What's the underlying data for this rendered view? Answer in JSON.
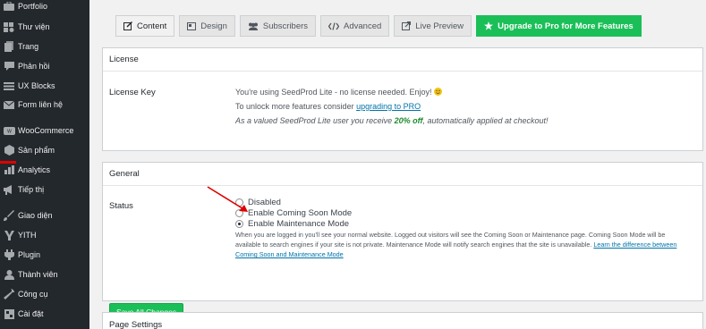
{
  "sidebar": {
    "items": [
      {
        "label": "Portfolio",
        "icon": "portfolio-icon"
      },
      {
        "label": "Thư viện",
        "icon": "media-icon"
      },
      {
        "label": "Trang",
        "icon": "pages-icon"
      },
      {
        "label": "Phản hồi",
        "icon": "comments-icon"
      },
      {
        "label": "UX Blocks",
        "icon": "blocks-icon"
      },
      {
        "label": "Form liên hệ",
        "icon": "mail-icon"
      },
      {
        "label": "WooCommerce",
        "icon": "woocommerce-icon"
      },
      {
        "label": "Sản phẩm",
        "icon": "products-icon"
      },
      {
        "label": "Analytics",
        "icon": "analytics-icon"
      },
      {
        "label": "Tiếp thị",
        "icon": "marketing-icon"
      },
      {
        "label": "Giao diện",
        "icon": "appearance-icon"
      },
      {
        "label": "YITH",
        "icon": "yith-icon"
      },
      {
        "label": "Plugin",
        "icon": "plugins-icon"
      },
      {
        "label": "Thành viên",
        "icon": "users-icon"
      },
      {
        "label": "Công cụ",
        "icon": "tools-icon"
      },
      {
        "label": "Cài đặt",
        "icon": "settings-icon"
      }
    ]
  },
  "tabs": [
    {
      "label": "Content",
      "icon": "edit-icon"
    },
    {
      "label": "Design",
      "icon": "design-icon"
    },
    {
      "label": "Subscribers",
      "icon": "subscribers-icon"
    },
    {
      "label": "Advanced",
      "icon": "code-icon"
    },
    {
      "label": "Live Preview",
      "icon": "external-icon"
    },
    {
      "label": "Upgrade to Pro for More Features",
      "icon": "star-icon"
    }
  ],
  "license": {
    "title": "License",
    "key_label": "License Key",
    "line1": "You're using SeedProd Lite - no license needed. Enjoy!",
    "line2_prefix": "To unlock more features consider",
    "line2_link": "upgrading to PRO",
    "line3_prefix": "As a valued SeedProd Lite user you receive",
    "line3_highlight": "20% off",
    "line3_suffix": ", automatically applied at checkout!"
  },
  "general": {
    "title": "General",
    "status_label": "Status",
    "options": [
      "Disabled",
      "Enable Coming Soon Mode",
      "Enable Maintenance Mode"
    ],
    "selected": "Enable Maintenance Mode",
    "desc_line1": "When you are logged in you'll see your normal website. Logged out visitors will see the Coming Soon or Maintenance page. Coming Soon Mode will be",
    "desc_line2": "available to search engines if your site is not private. Maintenance Mode will notify search engines that the site is unavailable.",
    "desc_link_part1": "Learn the difference between",
    "desc_link_part2": "Coming Soon and Maintenance Mode",
    "save_label": "Save All Changes"
  },
  "page_settings": {
    "title": "Page Settings"
  },
  "colors": {
    "sidebar_bg": "#23282d",
    "accent_green": "#1bbf58",
    "link_blue": "#0073aa",
    "arrow_red": "#e00000"
  }
}
